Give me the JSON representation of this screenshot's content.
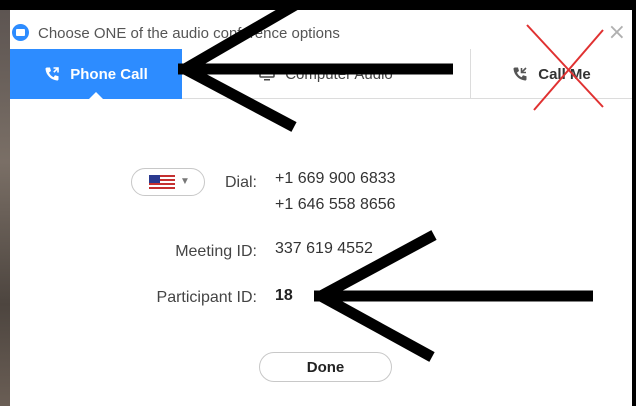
{
  "window": {
    "title": "Choose ONE of the audio conference options",
    "close_glyph": "×"
  },
  "tabs": [
    {
      "label": "Phone Call",
      "icon": "phone-icon",
      "active": true
    },
    {
      "label": "Computer Audio",
      "icon": "computer-icon",
      "active": false
    },
    {
      "label": "Call Me",
      "icon": "phone-icon",
      "active": false
    }
  ],
  "dial": {
    "country_flag": "us-flag-icon",
    "label": "Dial:",
    "numbers": [
      "+1 669 900 6833",
      "+1 646 558 8656"
    ]
  },
  "meeting": {
    "meeting_id_label": "Meeting ID:",
    "meeting_id": "337 619 4552",
    "participant_id_label": "Participant ID:",
    "participant_id": "18"
  },
  "actions": {
    "done_label": "Done"
  },
  "colors": {
    "accent": "#2d8cff",
    "annotation_arrow": "#000000",
    "annotation_cross": "#e03131"
  }
}
